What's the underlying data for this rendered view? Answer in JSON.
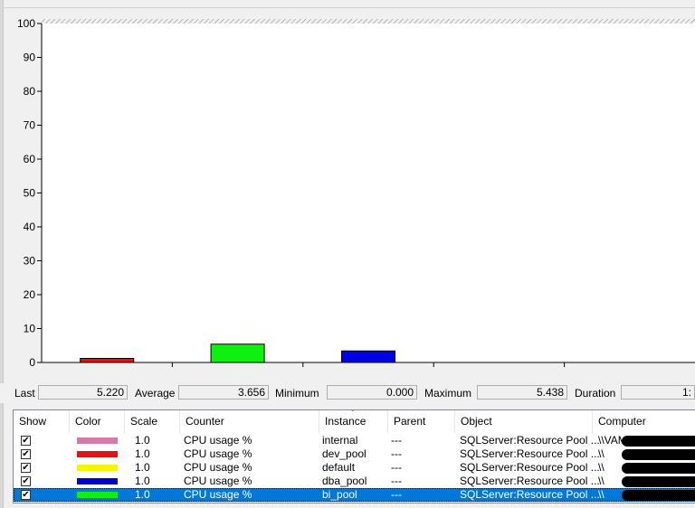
{
  "chart_data": {
    "type": "bar",
    "ylim": [
      0,
      100
    ],
    "yticks": [
      "100",
      "90",
      "80",
      "70",
      "60",
      "50",
      "40",
      "30",
      "20",
      "10",
      "0"
    ],
    "series": [
      {
        "value": 1.2,
        "color": "#e81010"
      },
      {
        "value": 5.4,
        "color": "#10f010"
      },
      {
        "value": 3.4,
        "color": "#0000e6"
      }
    ],
    "grid": false
  },
  "stats": {
    "last_label": "Last",
    "last_value": "5.220",
    "average_label": "Average",
    "average_value": "3.656",
    "minimum_label": "Minimum",
    "minimum_value": "0.000",
    "maximum_label": "Maximum",
    "maximum_value": "5.438",
    "duration_label": "Duration",
    "duration_value": "1:"
  },
  "columns": {
    "show": "Show",
    "color": "Color",
    "scale": "Scale",
    "counter": "Counter",
    "instance": "Instance",
    "parent": "Parent",
    "object": "Object",
    "computer": "Computer"
  },
  "rows": [
    {
      "checked": "✔",
      "color": "#d27aa8",
      "scale": "1.0",
      "counter": "CPU usage %",
      "instance": "internal",
      "parent": "---",
      "object": "SQLServer:Resource Pool ...",
      "computer": "\\\\VAM"
    },
    {
      "checked": "✔",
      "color": "#e81010",
      "scale": "1.0",
      "counter": "CPU usage %",
      "instance": "dev_pool",
      "parent": "---",
      "object": "SQLServer:Resource Pool ...",
      "computer": "\\\\"
    },
    {
      "checked": "✔",
      "color": "#f5f500",
      "scale": "1.0",
      "counter": "CPU usage %",
      "instance": "default",
      "parent": "---",
      "object": "SQLServer:Resource Pool ...",
      "computer": "\\\\"
    },
    {
      "checked": "✔",
      "color": "#0000c8",
      "scale": "1.0",
      "counter": "CPU usage %",
      "instance": "dba_pool",
      "parent": "---",
      "object": "SQLServer:Resource Pool ...",
      "computer": "\\\\"
    },
    {
      "checked": "✔",
      "color": "#10f010",
      "scale": "1.0",
      "counter": "CPU usage %",
      "instance": "bi_pool",
      "parent": "---",
      "object": "SQLServer:Resource Pool ...",
      "computer": "\\\\"
    }
  ]
}
